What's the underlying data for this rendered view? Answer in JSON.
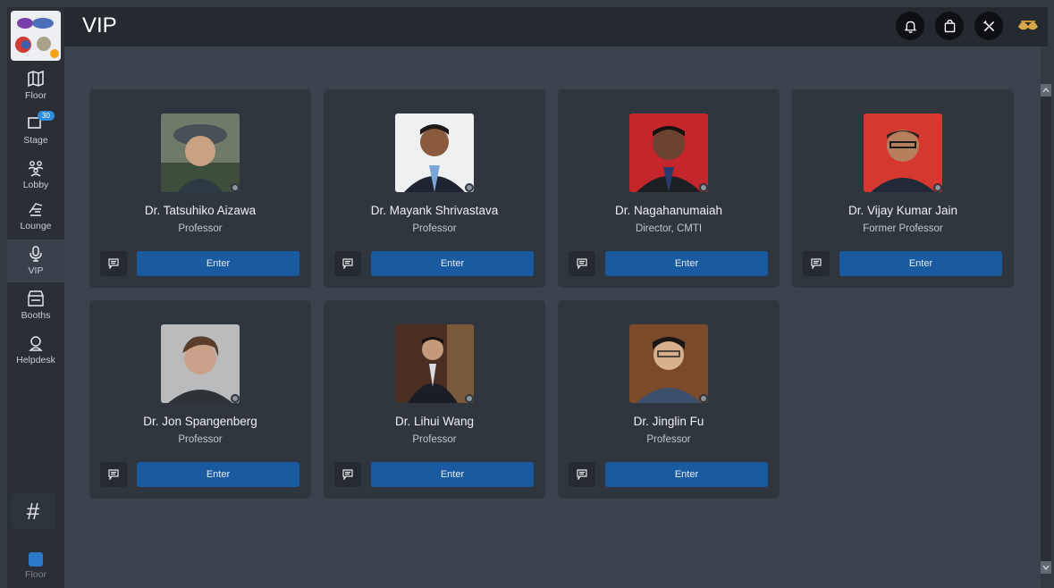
{
  "header": {
    "title": "VIP"
  },
  "sidebar": {
    "items": [
      {
        "label": "Floor",
        "icon": "map-icon"
      },
      {
        "label": "Stage",
        "icon": "stage-icon",
        "badge": "30"
      },
      {
        "label": "Lobby",
        "icon": "people-icon"
      },
      {
        "label": "Lounge",
        "icon": "lounge-icon"
      },
      {
        "label": "VIP",
        "icon": "microphone-icon",
        "active": true
      },
      {
        "label": "Booths",
        "icon": "booth-icon"
      },
      {
        "label": "Helpdesk",
        "icon": "helpdesk-icon"
      }
    ],
    "hash_label": "#",
    "floor_mini_label": "Floor"
  },
  "vips": [
    {
      "name": "Dr. Tatsuhiko Aizawa",
      "role": "Professor",
      "enter": "Enter"
    },
    {
      "name": "Dr. Mayank Shrivastava",
      "role": "Professor",
      "enter": "Enter"
    },
    {
      "name": "Dr. Nagahanumaiah",
      "role": "Director, CMTI",
      "enter": "Enter"
    },
    {
      "name": "Dr. Vijay Kumar Jain",
      "role": "Former Professor",
      "enter": "Enter"
    },
    {
      "name": "Dr. Jon Spangenberg",
      "role": "Professor",
      "enter": "Enter"
    },
    {
      "name": "Dr. Lihui Wang",
      "role": "Professor",
      "enter": "Enter"
    },
    {
      "name": "Dr. Jinglin Fu",
      "role": "Professor",
      "enter": "Enter"
    }
  ],
  "colors": {
    "accent": "#1a5aa0",
    "badge": "#2f8de0",
    "background": "#343a42",
    "card": "#30363e"
  }
}
